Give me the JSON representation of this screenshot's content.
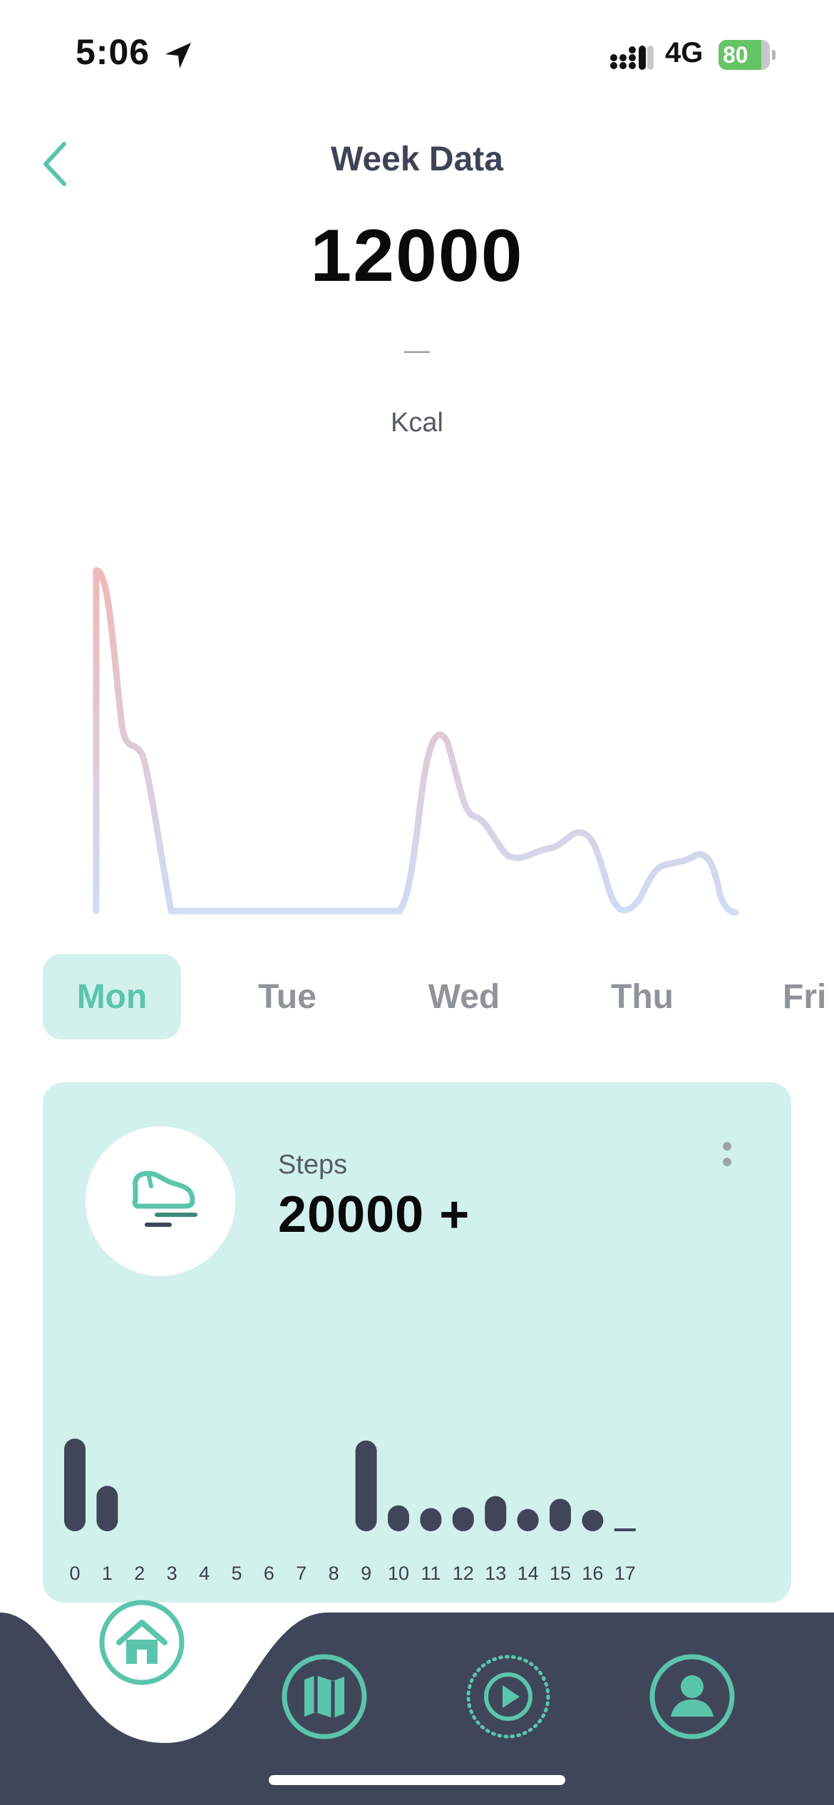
{
  "status_bar": {
    "time": "5:06",
    "network": "4G",
    "battery": "80",
    "icons": [
      "location-arrow-icon",
      "signal-icon",
      "battery-charging-icon"
    ]
  },
  "header": {
    "title": "Week Data",
    "back_icon": "chevron-left-icon"
  },
  "summary": {
    "value": "12000",
    "dash": "—",
    "unit": "Kcal"
  },
  "day_tabs": [
    {
      "label": "Mon",
      "active": true
    },
    {
      "label": "Tue",
      "active": false
    },
    {
      "label": "Wed",
      "active": false
    },
    {
      "label": "Thu",
      "active": false
    },
    {
      "label": "Fri",
      "active": false
    }
  ],
  "steps_card": {
    "label": "Steps",
    "value": "20000 +",
    "icon": "shoe-icon",
    "menu_icon": "more-vertical-icon",
    "hours": [
      "0",
      "1",
      "2",
      "3",
      "4",
      "5",
      "6",
      "7",
      "8",
      "9",
      "10",
      "11",
      "12",
      "13",
      "14",
      "15",
      "16",
      "17"
    ],
    "bar_levels": [
      1.0,
      0.49,
      0,
      0,
      0,
      0,
      0,
      0,
      0,
      0.98,
      0.28,
      0.25,
      0.26,
      0.38,
      0.24,
      0.35,
      0.23,
      0.02
    ]
  },
  "bottom_nav": {
    "items": [
      "home-icon",
      "map-icon",
      "play-icon",
      "profile-icon"
    ]
  },
  "colors": {
    "accent": "#5bc4ad",
    "card_bg": "#d2f1ec",
    "nav_bg": "#40465a",
    "title": "#3e4357",
    "curve_top": "#efb8b8",
    "curve_bottom": "#cfdcf4"
  }
}
